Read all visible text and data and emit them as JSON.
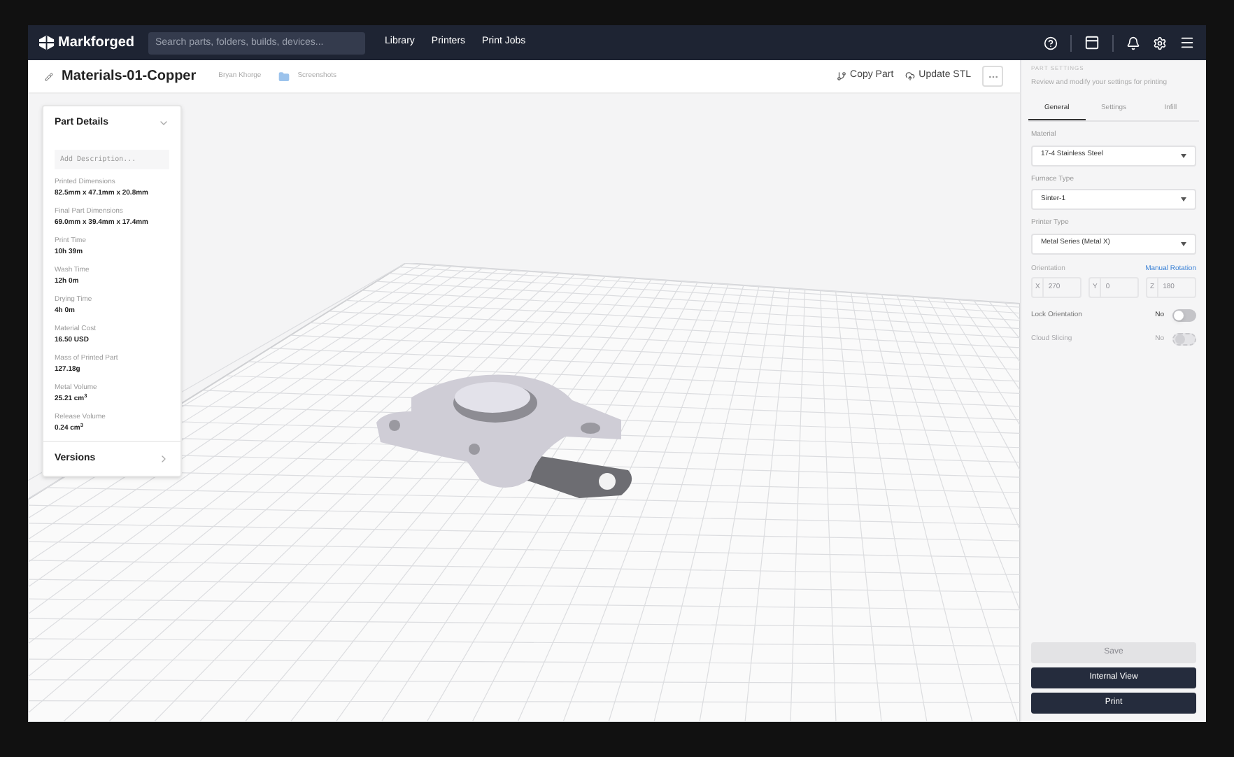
{
  "nav": {
    "brand": "Markforged",
    "search": {
      "placeholder": "Search parts, folders, builds, devices..."
    },
    "links": [
      "Library",
      "Printers",
      "Print Jobs"
    ]
  },
  "header": {
    "title": "Materials-01-Copper",
    "owner": "Bryan Khorge",
    "folder": "Screenshots",
    "actions": [
      "Copy Part",
      "Update STL"
    ]
  },
  "part_details": {
    "title": "Part Details",
    "expanded": true,
    "description": {
      "placeholder": "Add Description..."
    },
    "stats": [
      {
        "label": "Printed Dimensions",
        "value": "82.5mm x 47.1mm x 20.8mm"
      },
      {
        "label": "Final Part Dimensions",
        "value": "69.0mm x 39.4mm x 17.4mm"
      },
      {
        "label": "Print Time",
        "value": "10h 39m"
      },
      {
        "label": "Wash Time",
        "value": "12h 0m"
      },
      {
        "label": "Drying Time",
        "value": "4h 0m"
      },
      {
        "label": "Material Cost",
        "value": "16.50 USD"
      },
      {
        "label": "Mass of Printed Part",
        "value": "127.18g"
      },
      {
        "label": "Metal Volume",
        "value": "25.21 cm$^{3}$"
      },
      {
        "label": "Release Volume",
        "value": "0.24 cm$^{3}$"
      }
    ],
    "versions": "Versions"
  },
  "settings": {
    "heading": "PART SETTINGS",
    "subtitle": "Review and modify your settings for printing",
    "tabs": [
      {
        "label": "General",
        "selected": true
      },
      {
        "label": "Settings",
        "selected": false
      },
      {
        "label": "Infill",
        "selected": false
      }
    ],
    "selects": [
      {
        "label": "Material",
        "value": "17-4 Stainless Steel"
      },
      {
        "label": "Furnace Type",
        "value": "Sinter-1"
      },
      {
        "label": "Printer Type",
        "value": "Metal Series (Metal X)"
      }
    ],
    "orientation": {
      "label": "Orientation",
      "link": "Manual Rotation",
      "disabled": true,
      "axes": [
        {
          "axis": "X",
          "value": "270"
        },
        {
          "axis": "Y",
          "value": "0"
        },
        {
          "axis": "Z",
          "value": "180"
        }
      ]
    },
    "toggles": [
      {
        "label": "Lock Orientation",
        "state": "No",
        "on": false,
        "disabled": false
      },
      {
        "label": "Cloud Slicing",
        "state": "No",
        "on": false,
        "disabled": true
      }
    ],
    "buttons": [
      {
        "label": "Save",
        "disabled": true
      },
      {
        "label": "Internal View",
        "disabled": false
      },
      {
        "label": "Print",
        "disabled": false
      }
    ]
  }
}
